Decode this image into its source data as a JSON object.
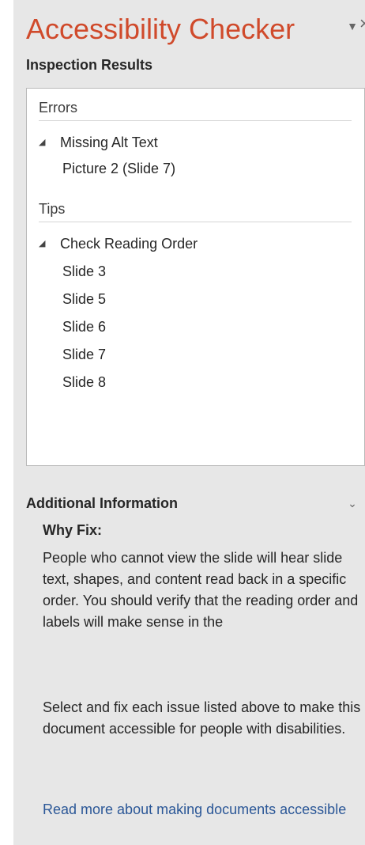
{
  "pane": {
    "title": "Accessibility Checker",
    "options_icon": "dropdown-triangle-icon",
    "close_icon": "close-icon",
    "options_glyph": "▼",
    "close_glyph": "×"
  },
  "inspection": {
    "heading": "Inspection Results",
    "errors_label": "Errors",
    "errors": [
      {
        "category": "Missing Alt Text",
        "expanded": true,
        "items": [
          "Picture 2  (Slide 7)"
        ]
      }
    ],
    "tips_label": "Tips",
    "tips": [
      {
        "category": "Check Reading Order",
        "expanded": true,
        "items": [
          "Slide 3",
          "Slide 5",
          "Slide 6",
          "Slide 7",
          "Slide 8"
        ]
      }
    ],
    "expanded_glyph": "◢"
  },
  "additional": {
    "heading": "Additional Information",
    "chevron_icon": "chevron-down-icon",
    "chevron_glyph": "⌄",
    "why_fix_label": "Why Fix:",
    "why_fix_text": "People who cannot view the slide will hear slide text, shapes, and content read back in a specific order. You should verify that the reading order and labels will make sense in the",
    "fix_text": "Select and fix each issue listed above to make this document accessible for people with disabilities.",
    "read_more_link": "Read more about making documents accessible"
  },
  "colors": {
    "title_accent": "#d04a2b",
    "pane_background": "#e7e7e7",
    "results_background": "#ffffff",
    "link": "#2b5797"
  }
}
